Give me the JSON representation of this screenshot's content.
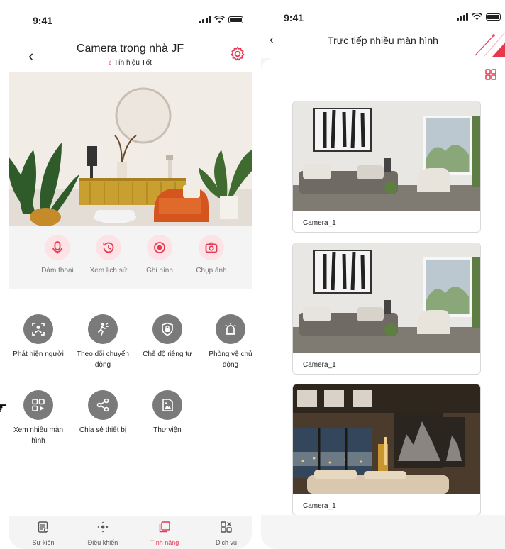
{
  "left": {
    "status_time": "9:41",
    "title": "Camera trong nhà JF",
    "signal_text": "Tín hiệu Tốt",
    "actions": [
      {
        "label": "Đàm thoại",
        "icon": "mic-icon"
      },
      {
        "label": "Xem lịch sử",
        "icon": "history-icon"
      },
      {
        "label": "Ghi hình",
        "icon": "record-icon"
      },
      {
        "label": "Chụp ảnh",
        "icon": "camera-icon"
      }
    ],
    "features": [
      {
        "label": "Phát hiện người",
        "icon": "person-detect-icon"
      },
      {
        "label": "Theo dõi chuyển động",
        "icon": "motion-track-icon"
      },
      {
        "label": "Chế độ riêng tư",
        "icon": "privacy-shield-icon"
      },
      {
        "label": "Phòng vệ chủ động",
        "icon": "alarm-icon"
      },
      {
        "label": "Xem nhiều màn hình",
        "icon": "multi-screen-icon"
      },
      {
        "label": "Chia sẻ thiết bị",
        "icon": "share-icon"
      },
      {
        "label": "Thư viện",
        "icon": "gallery-icon"
      }
    ],
    "tabs": [
      {
        "label": "Sự kiện",
        "icon": "events-icon",
        "active": false
      },
      {
        "label": "Điều khiển",
        "icon": "control-icon",
        "active": false
      },
      {
        "label": "Tính năng",
        "icon": "features-icon",
        "active": true
      },
      {
        "label": "Dịch vụ",
        "icon": "services-icon",
        "active": false
      }
    ]
  },
  "right": {
    "status_time": "9:41",
    "title": "Trực tiếp nhiều màn hình",
    "cameras": [
      {
        "name": "Camera_1"
      },
      {
        "name": "Camera_1"
      },
      {
        "name": "Camera_1"
      }
    ]
  },
  "colors": {
    "accent": "#e53950",
    "accent_light": "#fde3e6",
    "feature_circle": "#7a7a7a"
  }
}
